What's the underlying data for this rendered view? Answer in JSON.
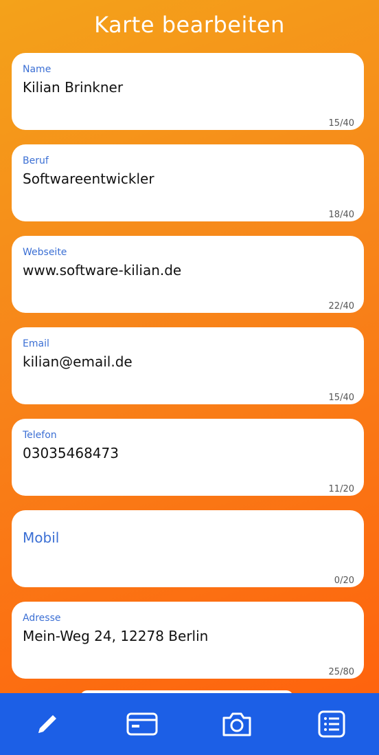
{
  "header": {
    "title": "Karte bearbeiten"
  },
  "fields": [
    {
      "label": "Name",
      "value": "Kilian Brinkner",
      "counter": "15/40"
    },
    {
      "label": "Beruf",
      "value": "Softwareentwickler",
      "counter": "18/40"
    },
    {
      "label": "Webseite",
      "value": "www.software-kilian.de",
      "counter": "22/40"
    },
    {
      "label": "Email",
      "value": "kilian@email.de",
      "counter": "15/40"
    },
    {
      "label": "Telefon",
      "value": "03035468473",
      "counter": "11/20"
    },
    {
      "label": "Mobil",
      "value": "",
      "counter": "0/20"
    },
    {
      "label": "Adresse",
      "value": "Mein-Weg 24, 12278 Berlin",
      "counter": "25/80"
    }
  ],
  "bottom_nav": {
    "items": [
      {
        "icon": "pencil-icon"
      },
      {
        "icon": "card-icon"
      },
      {
        "icon": "camera-icon"
      },
      {
        "icon": "list-icon"
      }
    ]
  },
  "colors": {
    "background_top": "#f4a21a",
    "background_bottom": "#ff5f0c",
    "nav_background": "#1c5fe6",
    "label_blue": "#3b6fd4"
  }
}
